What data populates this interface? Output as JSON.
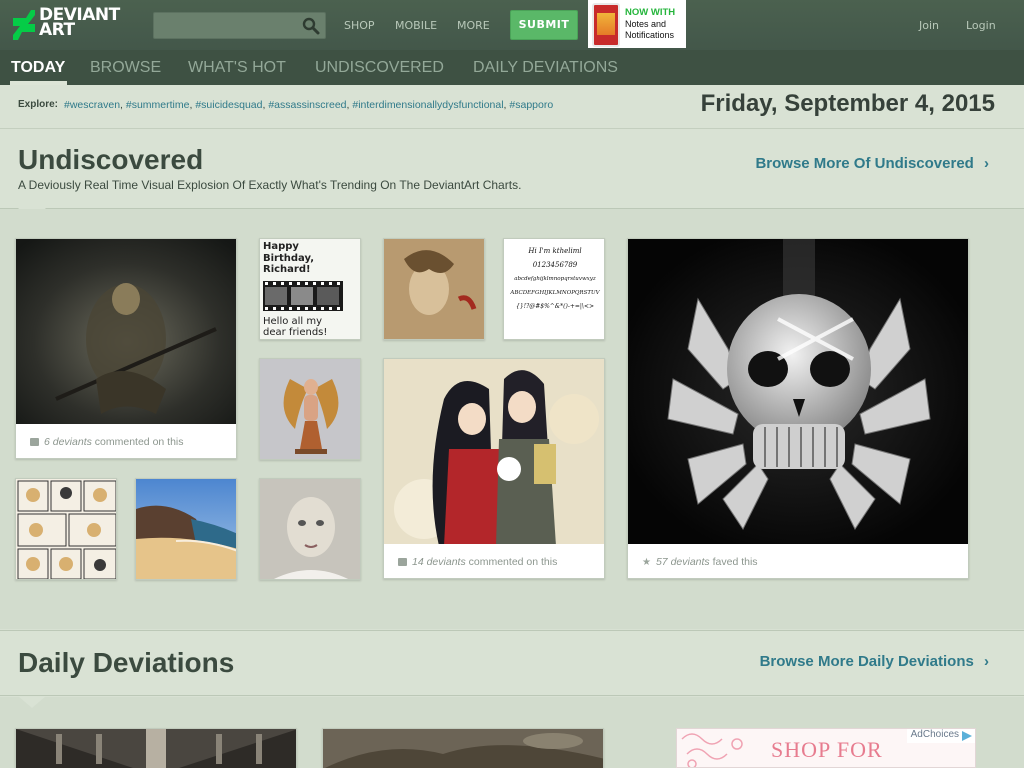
{
  "header": {
    "logo_line1": "DEVIANT",
    "logo_line2": "ART",
    "search_placeholder": "",
    "nav": [
      "SHOP",
      "MOBILE",
      "MORE"
    ],
    "submit_label": "SUBMIT",
    "promo_line1": "NOW WITH",
    "promo_line2": "Notes and",
    "promo_line3": "Notifications",
    "join_label": "Join",
    "login_label": "Login"
  },
  "subnav": {
    "tabs": [
      "TODAY",
      "BROWSE",
      "WHAT'S HOT",
      "UNDISCOVERED",
      "DAILY DEVIATIONS"
    ],
    "active": "TODAY"
  },
  "explore": {
    "label": "Explore:",
    "tags": [
      "#wescraven",
      "#summertime",
      "#suicidesquad",
      "#assassinscreed",
      "#interdimensionallydysfunctional",
      "#sapporo"
    ]
  },
  "date": "Friday, September 4, 2015",
  "undiscovered": {
    "title": "Undiscovered",
    "subtitle": "A Deviously Real Time Visual Explosion Of Exactly What's Trending On The DeviantArt Charts.",
    "more_link": "Browse More Of Undiscovered",
    "chevron": "›",
    "cards": [
      {
        "caption_count": "6 deviants",
        "caption_rest": " commented on this"
      },
      {
        "caption_count": "14 deviants",
        "caption_rest": " commented on this"
      },
      {
        "caption_count": "57 deviants",
        "caption_rest": " faved this"
      }
    ],
    "birthday_card": {
      "title_line1": "Happy",
      "title_line2": "Birthday,",
      "title_line3": "Richard!",
      "body_line1": "Hello all my",
      "body_line2": "dear friends!"
    },
    "font_sample": {
      "line1": "Hi I'm ktheliml",
      "line2": "0123456789",
      "line3": "abcdefghijklmnopqrstuvwxyz",
      "line4": "ABCDEFGHIJKLMNOPQRSTUV",
      "line5": "{}!?@#$%^&*()-+=|\\<>"
    }
  },
  "daily": {
    "title": "Daily Deviations",
    "more_link": "Browse More Daily Deviations",
    "chevron": "›"
  },
  "ad": {
    "text": "SHOP FOR",
    "choices": "AdChoices"
  },
  "colors": {
    "header_bg": "#475c4d",
    "subnav_bg": "#3e5143",
    "page_bg": "#d8e1d3",
    "link": "#307a8a",
    "submit": "#5ab868",
    "promo_green": "#25b53c"
  },
  "icons": [
    "search-icon",
    "deviantart-logo-icon",
    "comment-icon",
    "star-icon",
    "chevron-right-icon",
    "adchoices-icon"
  ]
}
